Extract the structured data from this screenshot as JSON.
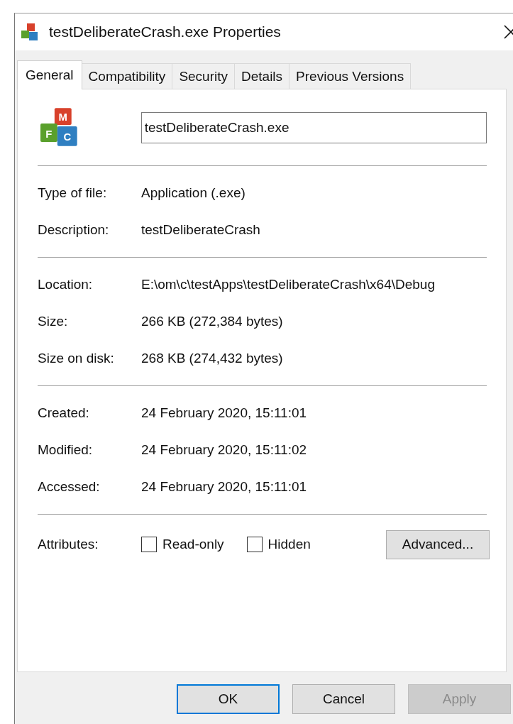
{
  "window": {
    "title": "testDeliberateCrash.exe Properties"
  },
  "tabs": [
    {
      "label": "General",
      "selected": true
    },
    {
      "label": "Compatibility",
      "selected": false
    },
    {
      "label": "Security",
      "selected": false
    },
    {
      "label": "Details",
      "selected": false
    },
    {
      "label": "Previous Versions",
      "selected": false
    }
  ],
  "app_icon_letters": [
    "M",
    "F",
    "C"
  ],
  "name_field": {
    "value": "testDeliberateCrash.exe"
  },
  "sections": [
    {
      "rows": [
        {
          "label": "Type of file:",
          "value": "Application (.exe)"
        },
        {
          "label": "Description:",
          "value": "testDeliberateCrash"
        }
      ]
    },
    {
      "rows": [
        {
          "label": "Location:",
          "value": "E:\\om\\c\\testApps\\testDeliberateCrash\\x64\\Debug"
        },
        {
          "label": "Size:",
          "value": "266 KB (272,384 bytes)"
        },
        {
          "label": "Size on disk:",
          "value": "268 KB (274,432 bytes)"
        }
      ]
    },
    {
      "rows": [
        {
          "label": "Created:",
          "value": "24 February 2020, 15:11:01"
        },
        {
          "label": "Modified:",
          "value": "24 February 2020, 15:11:02"
        },
        {
          "label": "Accessed:",
          "value": "24 February 2020, 15:11:01"
        }
      ]
    }
  ],
  "attributes": {
    "label": "Attributes:",
    "checkboxes": [
      {
        "label": "Read-only",
        "checked": false
      },
      {
        "label": "Hidden",
        "checked": false
      }
    ],
    "advanced_button": "Advanced..."
  },
  "buttons": [
    {
      "label": "OK",
      "kind": "default"
    },
    {
      "label": "Cancel",
      "kind": "normal"
    },
    {
      "label": "Apply",
      "kind": "disabled"
    }
  ]
}
